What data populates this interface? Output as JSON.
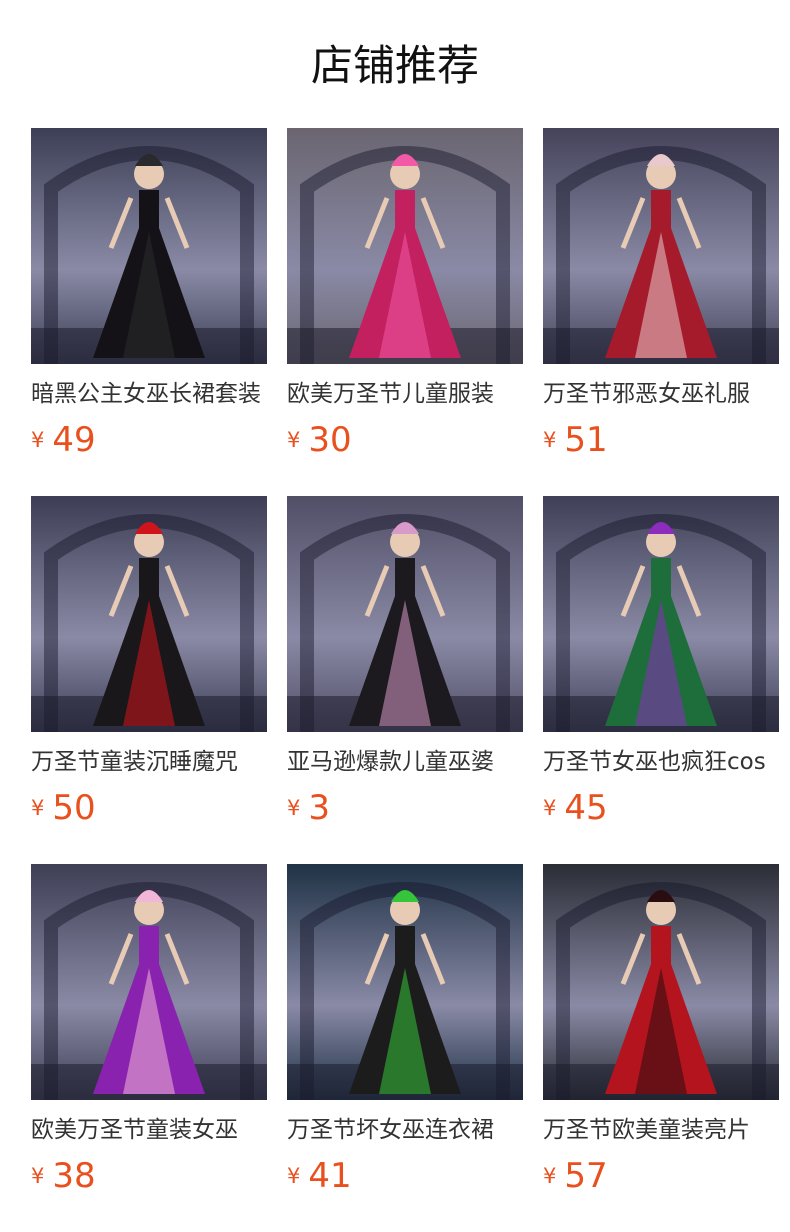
{
  "page": {
    "title": "店铺推荐"
  },
  "products": [
    {
      "name": "暗黑公主女巫长裙套装",
      "currency": "¥",
      "price": "49",
      "image": "gothic-princess-dress-photo",
      "bg": "#3c3f55",
      "dress": "#141216",
      "accent": "#2a2a2e"
    },
    {
      "name": "欧美万圣节儿童服装",
      "currency": "¥",
      "price": "30",
      "image": "pink-witch-tutu-photo",
      "bg": "#6a6570",
      "dress": "#c2205e",
      "accent": "#f25aa8"
    },
    {
      "name": "万圣节邪恶女巫礼服",
      "currency": "¥",
      "price": "51",
      "image": "red-hood-witch-photo",
      "bg": "#44435a",
      "dress": "#a51b2c",
      "accent": "#e9c9cc"
    },
    {
      "name": "万圣节童装沉睡魔咒",
      "currency": "¥",
      "price": "50",
      "image": "black-red-sorceress-photo",
      "bg": "#3d3e55",
      "dress": "#1a171a",
      "accent": "#d0141c"
    },
    {
      "name": "亚马逊爆款儿童巫婆",
      "currency": "¥",
      "price": "3",
      "image": "black-pink-witch-photo",
      "bg": "#514e66",
      "dress": "#1c1a1e",
      "accent": "#d79acb"
    },
    {
      "name": "万圣节女巫也疯狂cos",
      "currency": "¥",
      "price": "45",
      "image": "green-cape-witch-photo",
      "bg": "#3f4057",
      "dress": "#1d6e3a",
      "accent": "#8c2dbd"
    },
    {
      "name": "欧美万圣节童装女巫",
      "currency": "¥",
      "price": "38",
      "image": "purple-witch-broom-photo",
      "bg": "#3e3f55",
      "dress": "#8a22b0",
      "accent": "#f2b7d6"
    },
    {
      "name": "万圣节坏女巫连衣裙",
      "currency": "¥",
      "price": "41",
      "image": "green-black-witch-photo",
      "bg": "#1f3246",
      "dress": "#1c1c1c",
      "accent": "#35c43a"
    },
    {
      "name": "万圣节欧美童装亮片",
      "currency": "¥",
      "price": "57",
      "image": "red-black-sorceress-photo",
      "bg": "#2a2d35",
      "dress": "#b3141d",
      "accent": "#2a0d10"
    }
  ]
}
